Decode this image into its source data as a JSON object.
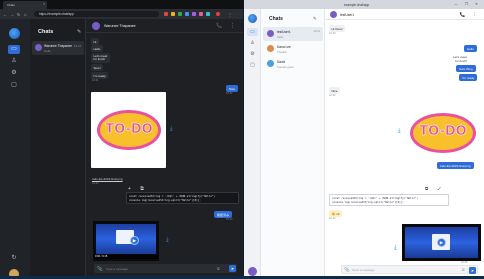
{
  "left_window": {
    "tab_label": "Chats",
    "url": "https://example.chat/app",
    "nav": {
      "back": "←",
      "forward": "→",
      "reload": "↻",
      "home": "⌂"
    },
    "ext_colors": [
      "#e0453a",
      "#f2b01e",
      "#31a853",
      "#4b8cf5",
      "#a560e8",
      "#e05fa0",
      "#37c2c9"
    ],
    "list_title": "Chats",
    "new_chat_icon": "✎",
    "chat_item": {
      "name": "Warunee Thapanee",
      "sub": "Hello",
      "time": "10:41"
    },
    "header": {
      "name": "Warunee Thapanee",
      "icons": "📞 ⋮"
    },
    "messages": {
      "b1": "Hi",
      "b2": "Hello",
      "b3": "Let's meet\nfor lunch",
      "b4": "Sure!",
      "b5": "I'm ready",
      "t1": "10:41",
      "me1": "Nice",
      "t2": "10:42",
      "image_text": "TO-DO",
      "link": "todo-list-2024-final.png",
      "t3": "10:43",
      "code_line1": "const receivedString = '<Q1>' + JSON.stringify(\"Hello\")",
      "code_line2": "console.log(receivedString.split(\"Hello\")[0]);",
      "code_tools": "+ ⧉",
      "me2": "確認済み",
      "t4": "10:44",
      "video_time": "0:00 / 0:15"
    },
    "input_placeholder": "Type a message",
    "input_icons": {
      "attach": "📎",
      "emoji": "☺",
      "send": "➤"
    }
  },
  "right_window": {
    "title": "example.chat/app",
    "win_buttons": "— ❐ ✕",
    "list_title": "Chats",
    "new_chat_icon": "✎",
    "items": [
      {
        "name": "testUser1",
        "sub": "Hello",
        "time": "10:41",
        "color": "#7a5cc7"
      },
      {
        "name": "Dana Lee",
        "sub": "Thanks!",
        "time": "",
        "color": "#e08a4a"
      },
      {
        "name": "David",
        "sub": "Sounds good",
        "time": "",
        "color": "#4aa0e0"
      }
    ],
    "header": {
      "name": "testUser1",
      "icons": "📞 ⋮"
    },
    "messages": {
      "b1": "Hi there!",
      "t1": "10:40",
      "me1": "Hello",
      "plain_me": "Let's meet\nfor lunch",
      "me2": "Sure thing",
      "me3": "I'm ready",
      "b2": "Nice",
      "t2": "10:42",
      "image_text": "TO-DO",
      "link": "todo-list-2024-final.png",
      "code_line1": "const receivedString = '<Q1>' + JSON.stringify(\"Hello\")",
      "code_line2": "console.log(receivedString.split(\"Hello\")[0]);",
      "code_tools": "⧉ ✓",
      "emoji_msg": "😊 Ok",
      "t3": "10:44",
      "t4": "10:45"
    },
    "input_placeholder": "Send a message",
    "input_icons": {
      "attach": "📎",
      "emoji": "☺",
      "send": "➤"
    }
  }
}
